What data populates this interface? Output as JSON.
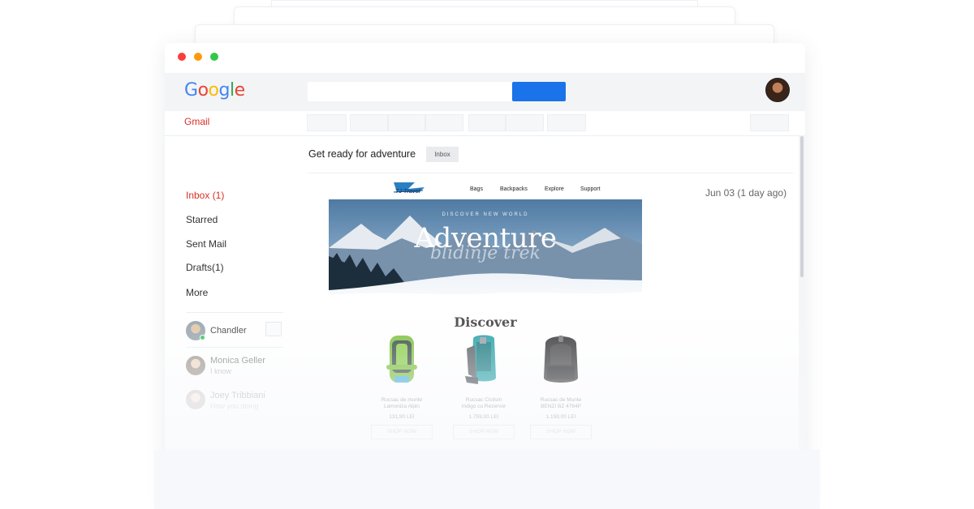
{
  "app": {
    "logo_text": "Google",
    "logo_colors": [
      "#4285F4",
      "#EA4335",
      "#FBBC05",
      "#4285F4",
      "#34A853",
      "#EA4335"
    ],
    "product_label": "Gmail"
  },
  "search": {
    "placeholder": "",
    "button_label": "",
    "button_color": "#1a73e8"
  },
  "message": {
    "subject": "Get ready for adventure",
    "label": "Inbox",
    "date": "Jun 03 (1 day ago)"
  },
  "sidebar": {
    "items": [
      {
        "label": "Inbox (1)",
        "active": true
      },
      {
        "label": "Starred",
        "active": false
      },
      {
        "label": "Sent Mail",
        "active": false
      },
      {
        "label": "Drafts(1)",
        "active": false
      },
      {
        "label": "More",
        "active": false
      }
    ],
    "contacts": [
      {
        "name": "Chandler",
        "status": "",
        "online": true
      },
      {
        "name": "Monica Geller",
        "status": "I know",
        "online": false
      },
      {
        "name": "Joey Tribbiani",
        "status": "How you doing",
        "online": false
      }
    ]
  },
  "email": {
    "brand": "TJ Travel",
    "menu": [
      "Bags",
      "Backpacks",
      "Explore",
      "Support"
    ],
    "hero_kicker": "DISCOVER NEW WORLD",
    "hero_title": "Adventure",
    "hero_script": "blidinje trek",
    "section_title": "Discover",
    "products": [
      {
        "name_line1": "Rucsac de munte",
        "name_line2": "Lamoniza Alpin",
        "price": "131,90 LEI",
        "button": "SHOP NOW",
        "color": "#7fc241"
      },
      {
        "name_line1": "Rucsac Ciclism",
        "name_line2": "Indigo cu Rezervor",
        "price": "1.759,00 LEI",
        "button": "SHOP NOW",
        "color": "#2ba3a8"
      },
      {
        "name_line1": "Rucsac de Munte",
        "name_line2": "BENZI BZ 4764P",
        "price": "1.159,00 LEI",
        "button": "SHOP NOW",
        "color": "#3b3b3d"
      }
    ]
  }
}
